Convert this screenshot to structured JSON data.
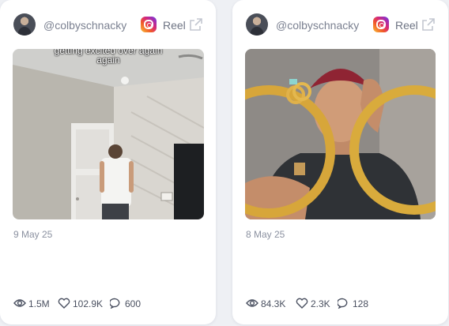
{
  "cards": [
    {
      "handle": "@colbyschnacky",
      "type_label": "Reel",
      "caption_line1": "getting excited over again",
      "caption_line2": "again",
      "date": "9 May 25",
      "views": "1.5M",
      "likes": "102.9K",
      "comments": "600"
    },
    {
      "handle": "@colbyschnacky",
      "type_label": "Reel",
      "date": "8 May 25",
      "views": "84.3K",
      "likes": "2.3K",
      "comments": "128"
    }
  ],
  "icons": {
    "platform": "instagram-icon",
    "open": "external-link-icon",
    "views": "eye-icon",
    "likes": "heart-icon",
    "comments": "comment-icon"
  },
  "colors": {
    "card_bg": "#ffffff",
    "page_bg": "#eef0f4",
    "muted_text": "#7b8191"
  }
}
